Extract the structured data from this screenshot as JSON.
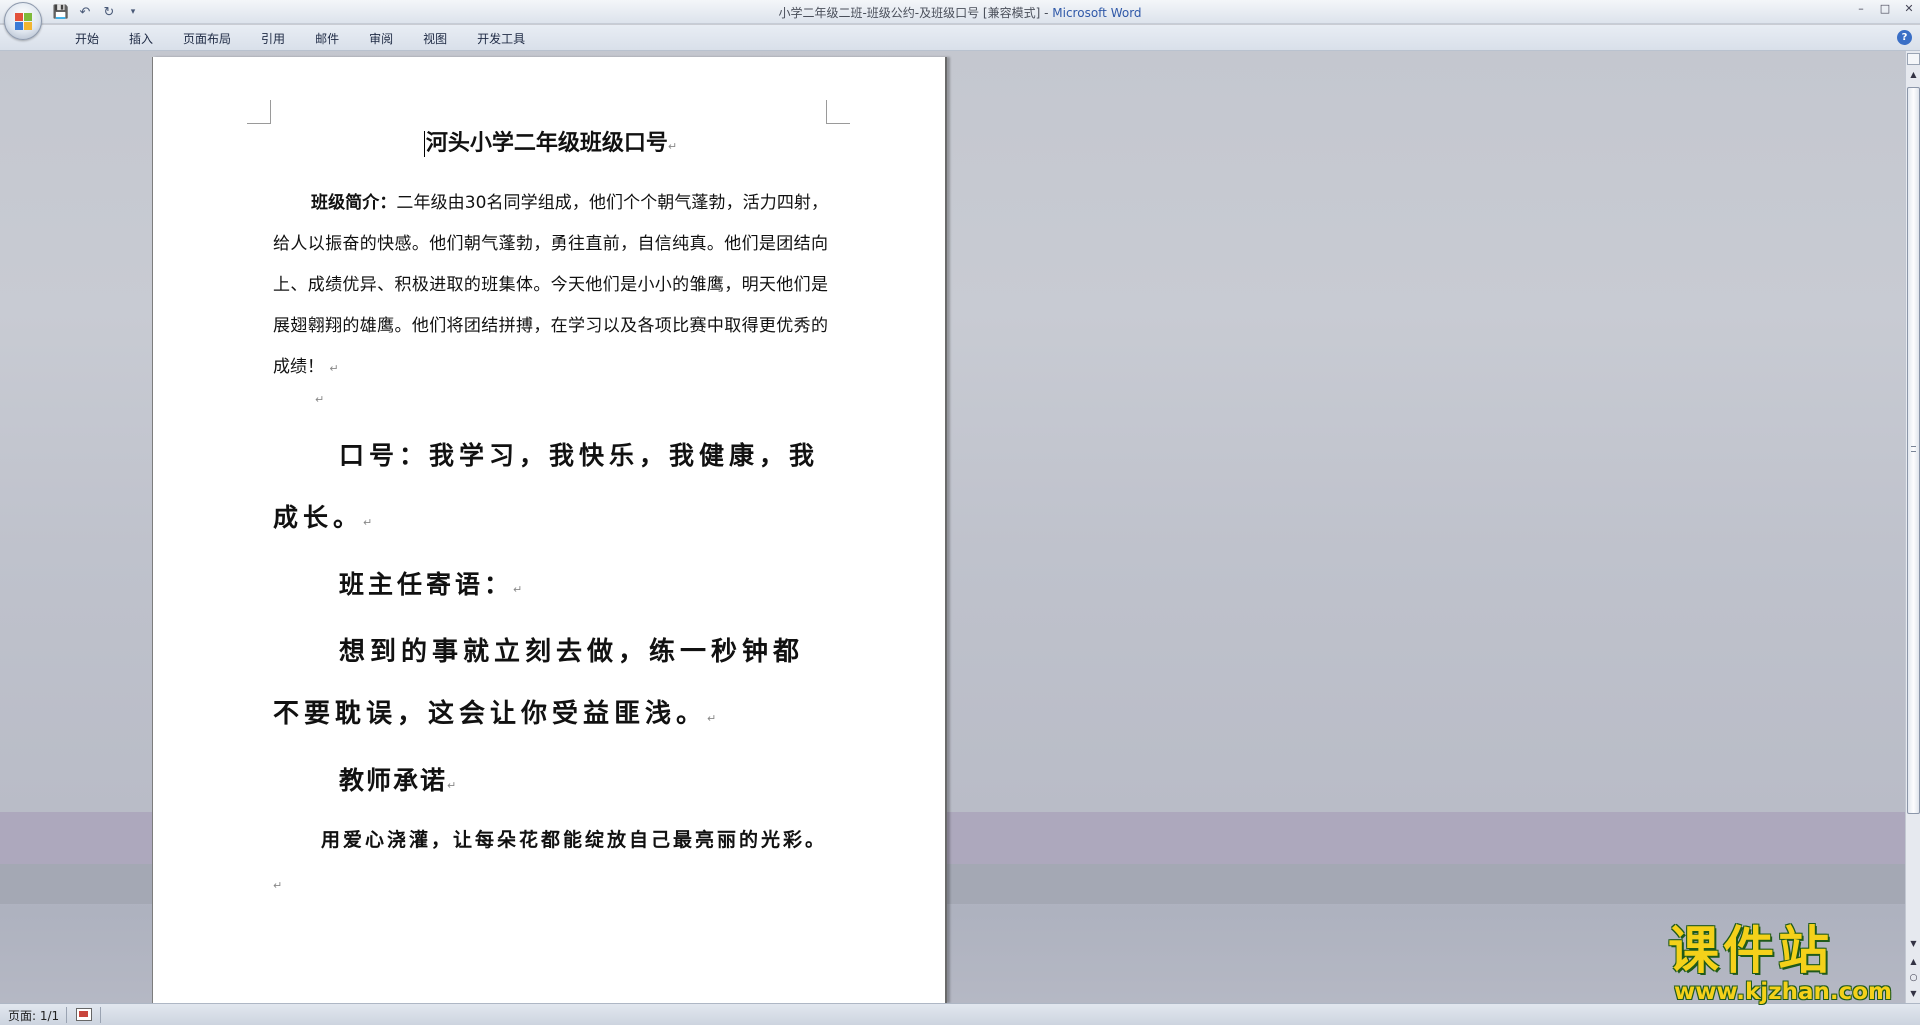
{
  "window": {
    "title": "小学二年级二班-班级公约-及班级口号 [兼容模式] - ",
    "app_name": "Microsoft Word"
  },
  "quick_access": {
    "save_icon": "save-icon",
    "undo_icon": "undo-icon",
    "redo_icon": "redo-icon",
    "customize_icon": "dropdown-icon"
  },
  "ribbon": {
    "tabs": [
      "开始",
      "插入",
      "页面布局",
      "引用",
      "邮件",
      "审阅",
      "视图",
      "开发工具"
    ]
  },
  "document": {
    "title": "河头小学二年级班级口号",
    "para_mark": "↵",
    "intro_label": "班级简介：",
    "intro_text": "二年级由30名同学组成，他们个个朝气蓬勃，活力四射，给人以振奋的快感。他们朝气蓬勃，勇往直前，自信纯真。他们是团结向上、成绩优异、积极进取的班集体。今天他们是小小的雏鹰，明天他们是展翅翱翔的雄鹰。他们将团结拼搏，在学习以及各项比赛中取得更优秀的成绩！",
    "slogan": "口号：我学习，我快乐，我健康，我成长。",
    "teacher_msg_label": "班主任寄语：",
    "teacher_msg": "想到的事就立刻去做，练一秒钟都不要耽误，这会让你受益匪浅。",
    "promise_label": "教师承诺",
    "promise": "用爱心浇灌，让每朵花都能绽放自己最亮丽的光彩。"
  },
  "statusbar": {
    "page": "页面: 1/1"
  },
  "watermark": {
    "text": "课件站",
    "url": "www.kjzhan.com"
  },
  "colors": {
    "app_name": "#2f58a8",
    "watermark": "#f4d11a",
    "watermark_outline": "#1f5a1a"
  }
}
